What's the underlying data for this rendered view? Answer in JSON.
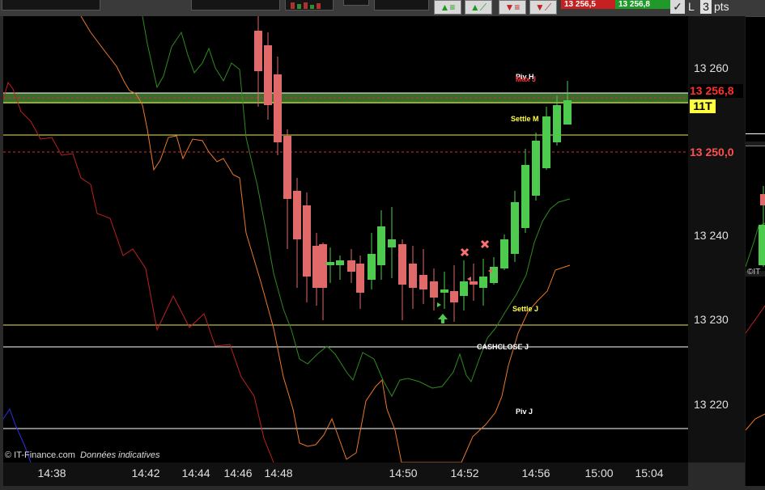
{
  "toolbar": {
    "icons": [
      "buy-stop-icon",
      "buy-limit-icon",
      "sell-stop-icon",
      "sell-limit-icon"
    ],
    "sell_price": "13 256,5",
    "buy_price": "13 256,8",
    "check_label": "L",
    "pts_value": "3",
    "pts_label": "pts"
  },
  "axis": {
    "ticks": [
      "13 260",
      "13 240",
      "13 230",
      "13 220"
    ],
    "current_price": "13 256,8",
    "order_price": "13 250,0",
    "tick_badge": "11T",
    "time_ticks": [
      "14:38",
      "14:42",
      "14:44",
      "14:46",
      "14:48",
      "14:50",
      "14:52",
      "14:56",
      "15:00",
      "15:04"
    ]
  },
  "levels": {
    "piv_h": "Piv H",
    "max_j": "Max J",
    "settle_m": "Settle M",
    "settle_j": "Settle J",
    "cashclose_j": "CASHCLOSE J",
    "piv_j": "Piv J"
  },
  "watermark": {
    "provider": "© IT-Finance.com",
    "note": "Données indicatives"
  },
  "side_panel": {
    "label": "IT"
  },
  "colors": {
    "up": "#4ecb4e",
    "down": "#e06a6a",
    "level_yellow": "#e8e85a",
    "level_white": "#ffffff",
    "band_green": "#3a6b2a",
    "ma_green": "#2e8b1e",
    "ma_orange": "#e8782a",
    "ma_red": "#c02020",
    "ma_blue": "#3030e0"
  }
}
